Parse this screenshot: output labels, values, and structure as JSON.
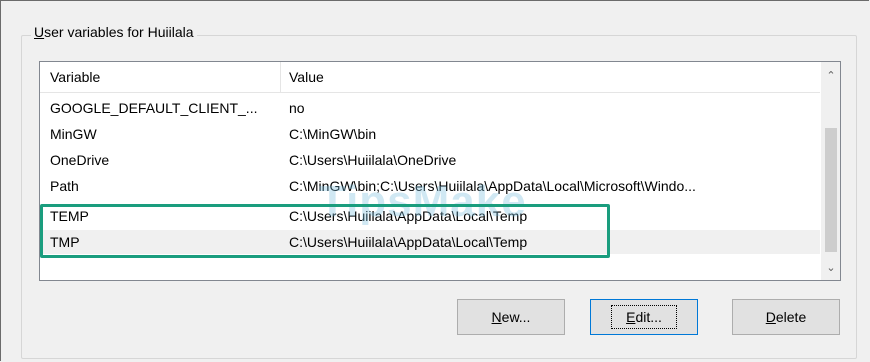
{
  "group": {
    "title_underlined": "U",
    "title_rest": "ser variables for Huiilala"
  },
  "columns": {
    "variable": "Variable",
    "value": "Value"
  },
  "rows": [
    {
      "variable": "GOOGLE_DEFAULT_CLIENT_...",
      "value": "no"
    },
    {
      "variable": "MinGW",
      "value": "C:\\MinGW\\bin"
    },
    {
      "variable": "OneDrive",
      "value": "C:\\Users\\Huiilala\\OneDrive"
    },
    {
      "variable": "Path",
      "value": "C:\\MinGW\\bin;C:\\Users\\Huiilala\\AppData\\Local\\Microsoft\\Windo..."
    },
    {
      "variable": "TEMP",
      "value": "C:\\Users\\Huiilala\\AppData\\Local\\Temp"
    },
    {
      "variable": "TMP",
      "value": "C:\\Users\\Huiilala\\AppData\\Local\\Temp"
    }
  ],
  "buttons": {
    "new_u": "N",
    "new_rest": "ew...",
    "edit_u": "E",
    "edit_rest": "dit...",
    "delete_u": "D",
    "delete_rest": "elete"
  },
  "watermark": "TipsMake",
  "icons": {
    "scroll_up": "chevron-up-icon",
    "scroll_down": "chevron-down-icon"
  },
  "colors": {
    "highlight": "#1a9d7e",
    "selected_row": "#f0f0f0"
  }
}
